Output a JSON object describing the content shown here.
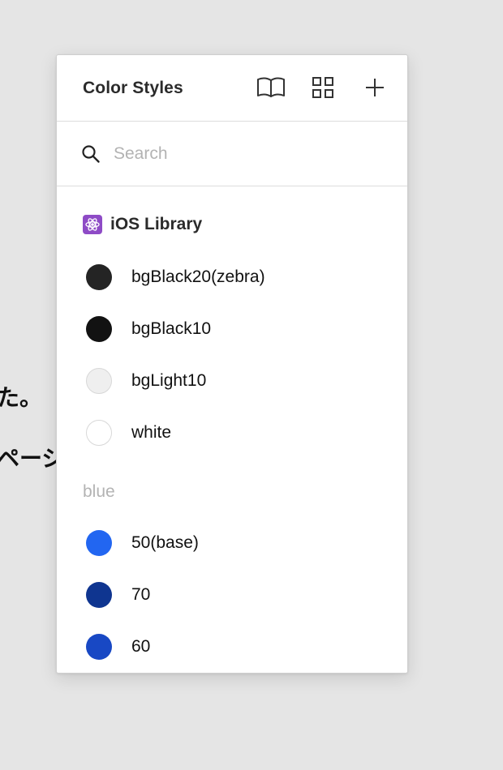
{
  "background": {
    "line1": "た。",
    "line2": "ページ"
  },
  "panel": {
    "title": "Color Styles",
    "search": {
      "placeholder": "Search",
      "value": ""
    },
    "library": {
      "name": "iOS Library",
      "items": [
        {
          "label": "bgBlack20(zebra)",
          "color": "#242424"
        },
        {
          "label": "bgBlack10",
          "color": "#121212"
        },
        {
          "label": "bgLight10",
          "color": "#efefef"
        },
        {
          "label": "white",
          "color": "#ffffff"
        }
      ]
    },
    "groups": [
      {
        "name": "blue",
        "items": [
          {
            "label": "50(base)",
            "color": "#2266f1"
          },
          {
            "label": "70",
            "color": "#0f3590"
          },
          {
            "label": "60",
            "color": "#1848c4"
          }
        ]
      }
    ]
  }
}
